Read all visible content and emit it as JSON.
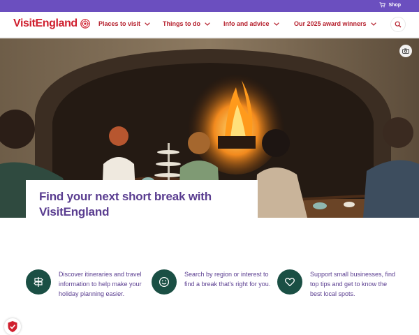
{
  "topbar": {
    "shop_label": "Shop"
  },
  "brand": {
    "logo_text": "VisitEngland",
    "color": "#cf1f2e"
  },
  "nav": {
    "items": [
      {
        "label": "Places to visit"
      },
      {
        "label": "Things to do"
      },
      {
        "label": "Info and advice"
      },
      {
        "label": "Our 2025 award winners"
      }
    ]
  },
  "hero": {
    "headline": "Find your next short break with VisitEngland",
    "image_icon": "camera-icon"
  },
  "features": [
    {
      "icon": "signpost-icon",
      "text": "Discover itineraries and travel information to help make your holiday planning easier."
    },
    {
      "icon": "smiley-icon",
      "text": "Search by region or interest to find a break that's right for you."
    },
    {
      "icon": "heart-icon",
      "text": "Support small businesses, find top tips and get to know the best local spots."
    }
  ],
  "colors": {
    "topbar": "#6b4fbf",
    "nav_text": "#b51f2c",
    "headline": "#5a3d90",
    "feature_icon_bg": "#1a4f44",
    "feature_text": "#5a3d90"
  }
}
